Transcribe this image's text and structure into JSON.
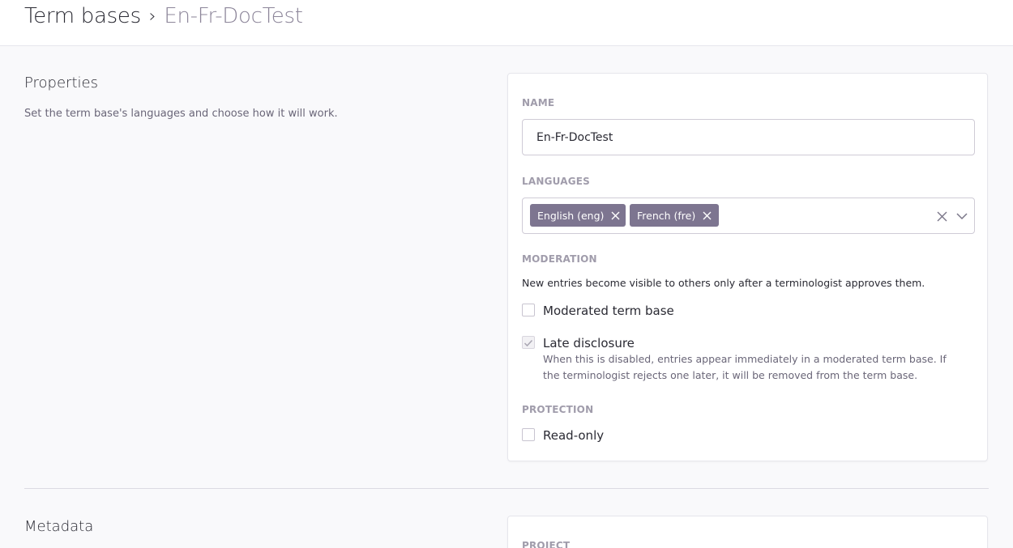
{
  "breadcrumb": {
    "root": "Term bases",
    "separator": "›",
    "current": "En-Fr-DocTest"
  },
  "properties": {
    "title": "Properties",
    "description": "Set the term base's languages and choose how it will work.",
    "name_label": "NAME",
    "name_value": "En-Fr-DocTest",
    "languages_label": "LANGUAGES",
    "languages": [
      "English (eng)",
      "French (fre)"
    ],
    "moderation_label": "MODERATION",
    "moderation_help": "New entries become visible to others only after a terminologist approves them.",
    "moderated_label": "Moderated term base",
    "moderated_checked": false,
    "late_disclosure_label": "Late disclosure",
    "late_disclosure_checked": true,
    "late_disclosure_help": "When this is disabled, entries appear immediately in a moderated term base. If the terminologist rejects one later, it will be removed from the term base.",
    "protection_label": "PROTECTION",
    "readonly_label": "Read-only",
    "readonly_checked": false
  },
  "metadata": {
    "title": "Metadata",
    "project_label": "PROJECT"
  },
  "colors": {
    "tag_bg": "#7d7590",
    "label_gray": "#a09cab",
    "crumb_current": "#8c8599"
  },
  "icons": {
    "tag_remove": "close-icon",
    "clear": "close-icon",
    "toggle": "chevron-down-icon",
    "checkmark": "check-icon"
  }
}
